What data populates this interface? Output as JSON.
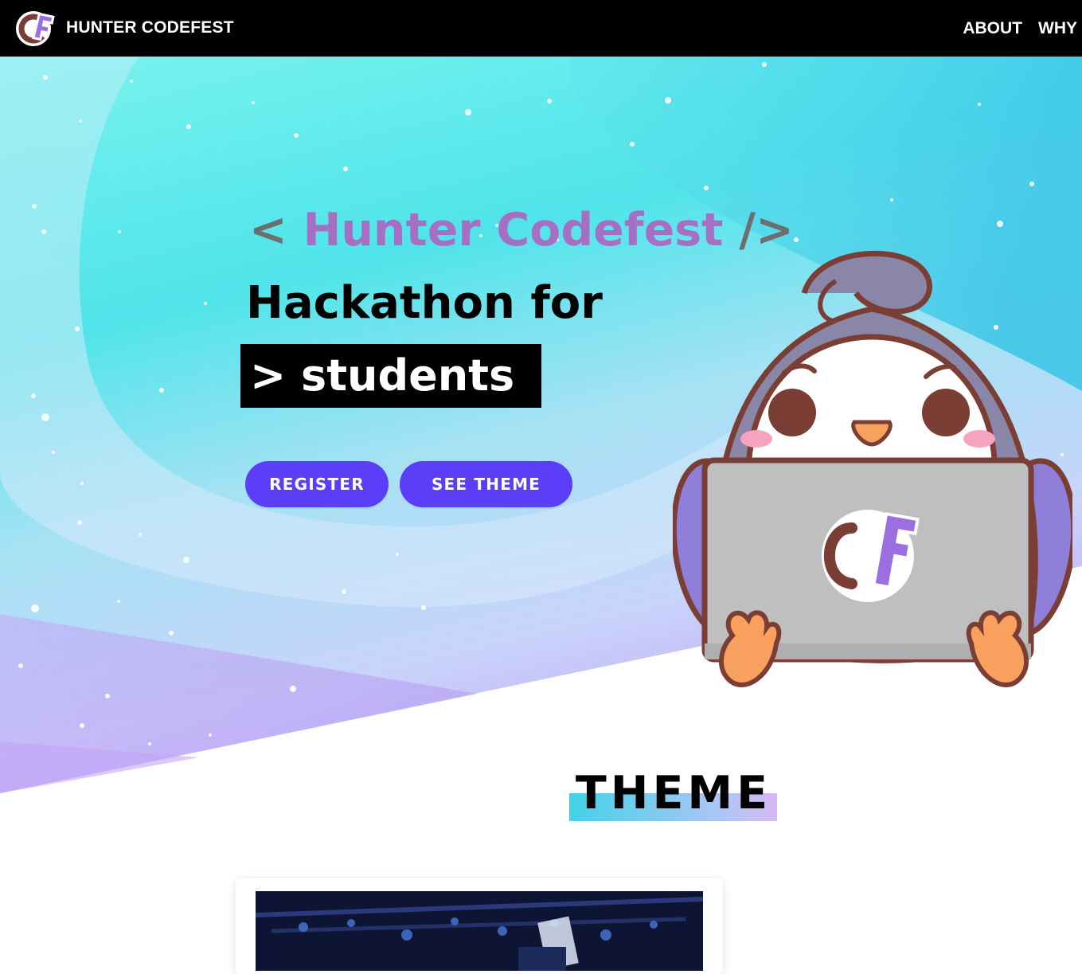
{
  "navbar": {
    "logo_text": "CF",
    "brand": "HUNTER CODEFEST",
    "links": [
      {
        "label": "ABOUT"
      },
      {
        "label": "WHY"
      }
    ]
  },
  "hero": {
    "open_bracket": "<",
    "title": "Hunter Codefest",
    "close_bracket": "/>",
    "headline": "Hackathon for",
    "typed_text": ">  students",
    "buttons": {
      "register": "REGISTER",
      "see_theme": "SEE THEME"
    },
    "mascot_laptop_logo": "CF"
  },
  "theme_section": {
    "heading": "THEME"
  },
  "colors": {
    "nav_bg": "#000000",
    "title_purple": "#a66fc4",
    "button": "#5b3ff8",
    "hero_gradient_start": "#74f1ee",
    "hero_gradient_end": "#c7a9f7"
  }
}
